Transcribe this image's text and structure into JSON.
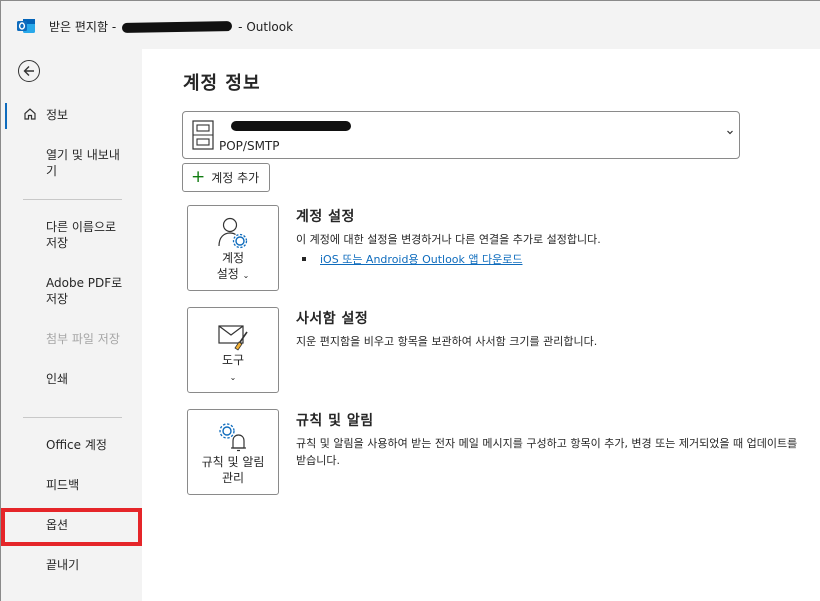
{
  "window": {
    "title_prefix": "받은 편지함 -",
    "title_suffix": "-  Outlook"
  },
  "sidebar": {
    "items": [
      {
        "label": "정보"
      },
      {
        "label": "열기 및 내보내기"
      },
      {
        "label": "다른 이름으로 저장"
      },
      {
        "label": "Adobe PDF로 저장"
      },
      {
        "label": "첨부 파일 저장"
      },
      {
        "label": "인쇄"
      },
      {
        "label": "Office 계정"
      },
      {
        "label": "피드백"
      },
      {
        "label": "옵션"
      },
      {
        "label": "끝내기"
      }
    ],
    "highlight_color": "#e52529"
  },
  "main": {
    "title": "계정 정보",
    "account": {
      "type": "POP/SMTP"
    },
    "add_account_label": "계정 추가",
    "sections": [
      {
        "button_label_1": "계정",
        "button_label_2": "설정",
        "title": "계정 설정",
        "desc": "이 계정에 대한 설정을 변경하거나 다른 연결을 추가로 설정합니다.",
        "link": "iOS 또는 Android용 Outlook 앱 다운로드"
      },
      {
        "button_label_1": "도구",
        "title": "사서함 설정",
        "desc": "지운 편지함을 비우고 항목을 보관하여 사서함 크기를 관리합니다."
      },
      {
        "button_label_1": "규칙 및 알림",
        "button_label_2": "관리",
        "title": "규칙 및 알림",
        "desc": "규칙 및 알림을 사용하여 받는 전자 메일 메시지를 구성하고 항목이 추가, 변경 또는 제거되었을 때 업데이트를 받습니다."
      }
    ]
  },
  "colors": {
    "accent": "#0f6cbd",
    "sidebar_bg": "#f3f3f3",
    "add_plus": "#107c10"
  }
}
